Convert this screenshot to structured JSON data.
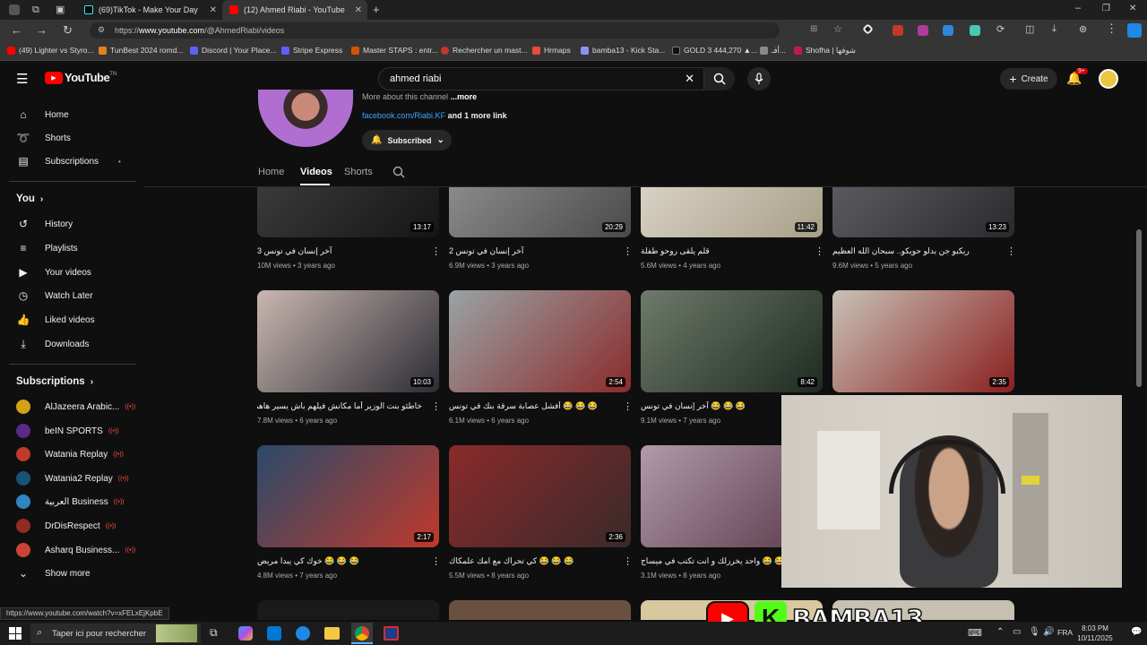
{
  "browser": {
    "tabs": [
      {
        "title": "(69)TikTok - Make Your Day"
      },
      {
        "title": "(12) Ahmed Riabi - YouTube"
      }
    ],
    "url_prefix": "https://",
    "url_domain": "www.youtube.com",
    "url_path": "/@AhmedRiabi/videos",
    "bookmarks": [
      {
        "label": "(49) Lighter vs Styro...",
        "color": "#ff0000"
      },
      {
        "label": "TunBest 2024 romd...",
        "color": "#e67e22"
      },
      {
        "label": "Discord | Your Place...",
        "color": "#5865f2"
      },
      {
        "label": "Stripe Express",
        "color": "#635bff"
      },
      {
        "label": "Master STAPS : entr...",
        "color": "#d35400"
      },
      {
        "label": "Rechercher un mast...",
        "color": "#c0392b"
      },
      {
        "label": "Hrmaps",
        "color": "#e74c3c"
      },
      {
        "label": "bamba13 - Kick Sta...",
        "color": "#8e8ef5"
      },
      {
        "label": "GOLD 3 444,270 ▲...",
        "color": "#111111"
      },
      {
        "label": "أفـ...",
        "color": "#888888"
      },
      {
        "label": "Shofha | شوفها",
        "color": "#c2185b"
      }
    ]
  },
  "youtube": {
    "logo": "YouTube",
    "logo_suffix": "TN",
    "search_value": "ahmed riabi",
    "create_label": "Create",
    "notif_count": "9+"
  },
  "sidebar": {
    "main": [
      {
        "label": "Home",
        "icon": "home-icon",
        "glyph": "⌂"
      },
      {
        "label": "Shorts",
        "icon": "shorts-icon",
        "glyph": "➰"
      },
      {
        "label": "Subscriptions",
        "icon": "subscriptions-icon",
        "glyph": "▤"
      }
    ],
    "you_heading": "You",
    "you": [
      {
        "label": "History",
        "icon": "history-icon",
        "glyph": "↺"
      },
      {
        "label": "Playlists",
        "icon": "playlists-icon",
        "glyph": "≡"
      },
      {
        "label": "Your videos",
        "icon": "your-videos-icon",
        "glyph": "▶"
      },
      {
        "label": "Watch Later",
        "icon": "watch-later-icon",
        "glyph": "◷"
      },
      {
        "label": "Liked videos",
        "icon": "liked-videos-icon",
        "glyph": "👍"
      },
      {
        "label": "Downloads",
        "icon": "downloads-icon",
        "glyph": "⤓"
      }
    ],
    "subs_heading": "Subscriptions",
    "subs": [
      {
        "label": "AlJazeera Arabic...",
        "color": "#d4a017"
      },
      {
        "label": "beIN SPORTS",
        "color": "#5b2a86"
      },
      {
        "label": "Watania Replay",
        "color": "#c0392b"
      },
      {
        "label": "Watania2 Replay",
        "color": "#1a5276"
      },
      {
        "label": "العربية Business",
        "color": "#2e86c1"
      },
      {
        "label": "DrDisRespect",
        "color": "#922b21"
      },
      {
        "label": "Asharq Business...",
        "color": "#cb4335"
      }
    ],
    "show_more": "Show more"
  },
  "channel": {
    "about": "More about this channel",
    "about_more": "...more",
    "link": "facebook.com/Riabi.KF",
    "link_more": "and 1 more link",
    "subscribed": "Subscribed",
    "tabs": [
      "Home",
      "Videos",
      "Shorts"
    ]
  },
  "videos": [
    {
      "title": "آخر إنسان في تونس 3",
      "views": "10M views",
      "age": "3 years ago",
      "duration": "13:17",
      "c1": "#3a3a3a",
      "c2": "#151515"
    },
    {
      "title": "آخر إنسان في تونس 2",
      "views": "6.9M views",
      "age": "3 years ago",
      "duration": "20:29",
      "c1": "#8a8a8a",
      "c2": "#4a4a4a"
    },
    {
      "title": "قلم يلقى روحو طفلة",
      "views": "5.6M views",
      "age": "4 years ago",
      "duration": "11:42",
      "c1": "#d8d2c4",
      "c2": "#a89e88"
    },
    {
      "title": "ريكبو جن بدلو حويكو.. سبحان الله العظيم",
      "views": "9.6M views",
      "age": "5 years ago",
      "duration": "13:23",
      "c1": "#5a5a60",
      "c2": "#2a2a2e"
    },
    {
      "title": "خاطئو بنت الوزير أما مكانش فيلهم باش يسير هاهم هذا الكل",
      "views": "7.8M views",
      "age": "6 years ago",
      "duration": "10:03",
      "c1": "#c9b7b0",
      "c2": "#2c2c34"
    },
    {
      "title": "😂 😂 😂 أفشل عصابة سرقة بنك في تونس",
      "views": "6.1M views",
      "age": "6 years ago",
      "duration": "2:54",
      "c1": "#9aa3a6",
      "c2": "#8b2b2b"
    },
    {
      "title": "😂 😂 😂 آخر إنسان في تونس",
      "views": "9.1M views",
      "age": "7 years ago",
      "duration": "8:42",
      "c1": "#6e7a6a",
      "c2": "#1f2a22"
    },
    {
      "title": "",
      "views": "",
      "age": "",
      "duration": "2:35",
      "c1": "#c8c2b6",
      "c2": "#8a1f1f"
    },
    {
      "title": "😂 😂 😂 خوك كي يبدا مريض",
      "views": "4.8M views",
      "age": "7 years ago",
      "duration": "2:17",
      "c1": "#2a4a6a",
      "c2": "#c0392b"
    },
    {
      "title": "😂 😂 😂 كي تحراك مع امك علمكاك",
      "views": "5.5M views",
      "age": "8 years ago",
      "duration": "2:36",
      "c1": "#8a2a2a",
      "c2": "#3a2a2a"
    },
    {
      "title": "😂 😂 😂 واحد يخرزلك و انت تكتب في ميساج",
      "views": "3.1M views",
      "age": "8 years ago",
      "duration": "",
      "c1": "#b29aa8",
      "c2": "#5a3a4a"
    }
  ],
  "status_url": "https://www.youtube.com/watch?v=xFELxEjKpbE",
  "overlay": {
    "brand": "BAMBA13",
    "kick_letter": "K"
  },
  "taskbar": {
    "search_placeholder": "Taper ici pour rechercher",
    "lang": "FRA",
    "time": "8:03 PM",
    "date": "10/11/2025"
  }
}
